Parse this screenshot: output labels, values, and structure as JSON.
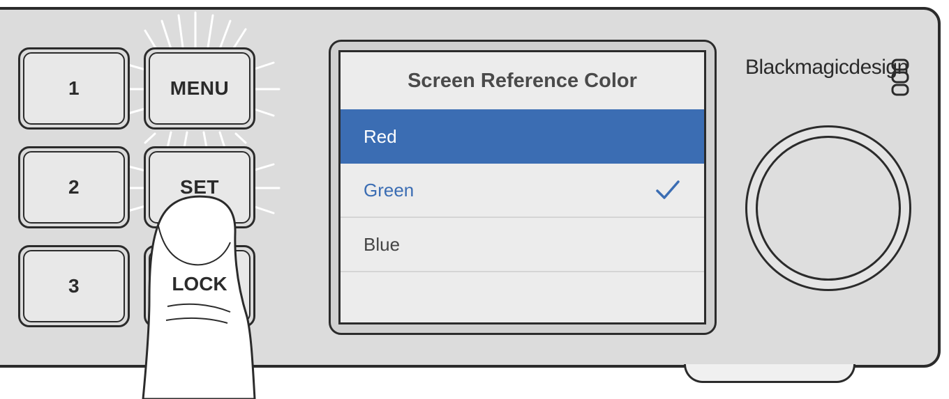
{
  "buttons": {
    "one": "1",
    "two": "2",
    "three": "3",
    "menu": "MENU",
    "set": "SET",
    "lock": "LOCK"
  },
  "screen": {
    "title": "Screen Reference Color",
    "items": [
      {
        "label": "Red",
        "selected": true,
        "checked": false
      },
      {
        "label": "Green",
        "selected": false,
        "checked": true
      },
      {
        "label": "Blue",
        "selected": false,
        "checked": false
      }
    ]
  },
  "brand": {
    "name": "Blackmagicdesign"
  },
  "icons": {
    "check": "check-icon",
    "logo": "blackmagic-logo-icon",
    "knob": "rotary-knob"
  },
  "colors": {
    "highlight": "#3b6db3",
    "panel": "#dcdcdc",
    "outline": "#2b2b2b"
  }
}
